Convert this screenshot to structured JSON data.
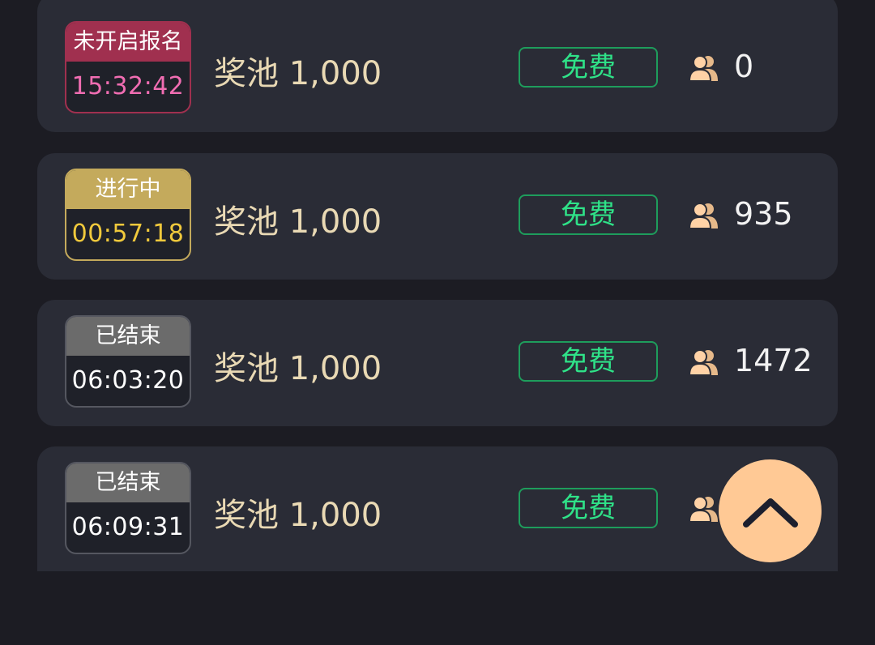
{
  "colors": {
    "background": "#1c1c23",
    "card": "#2a2c36",
    "pool_text": "#e9d9b4",
    "fee_text": "#2fe288",
    "fee_border": "#1e9d5c",
    "scroll_button": "#ffc995"
  },
  "scroll_top_icon": "chevron-up-icon",
  "player_icon": "users-icon",
  "tournaments": [
    {
      "status": "未开启报名",
      "time": "15:32:42",
      "status_color": "#a0304f",
      "time_color": "#f06db2",
      "pool": "奖池 1,000",
      "fee": "免费",
      "players": "0"
    },
    {
      "status": "进行中",
      "time": "00:57:18",
      "status_color": "#c4aa5c",
      "time_color": "#f0c93c",
      "pool": "奖池 1,000",
      "fee": "免费",
      "players": "935"
    },
    {
      "status": "已结束",
      "time": "06:03:20",
      "status_color": "#6b6b6b",
      "time_color": "#ffffff",
      "pool": "奖池 1,000",
      "fee": "免费",
      "players": "1472"
    },
    {
      "status": "已结束",
      "time": "06:09:31",
      "status_color": "#6b6b6b",
      "time_color": "#ffffff",
      "pool": "奖池 1,000",
      "fee": "免费",
      "players": ""
    }
  ]
}
